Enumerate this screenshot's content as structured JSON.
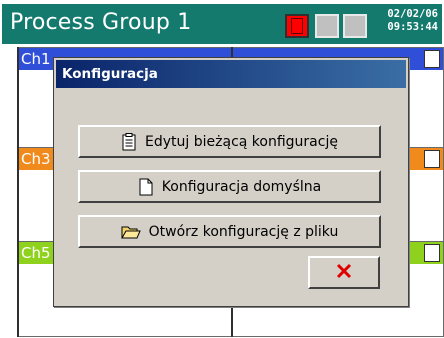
{
  "recorder": {
    "title": "Process Group 1",
    "date": "02/02/06",
    "time": "09:53:44",
    "channels": {
      "ch_top": "Ch1",
      "ch_mid": "Ch3",
      "ch_bot": "Ch5"
    }
  },
  "dialog": {
    "title": "Konfiguracja",
    "buttons": {
      "edit_current": "Edytuj bieżącą konfigurację",
      "default_config": "Konfiguracja domyślna",
      "open_from_file": "Otwórz konfigurację z pliku"
    }
  },
  "colors": {
    "titlebar": "#147a6e",
    "ch1": "#2f4fd8",
    "ch2": "#2f4fd8",
    "ch3": "#f08a1c",
    "ch4": "#f08a1c",
    "ch5": "#8fd21e",
    "ch6": "#8fd21e",
    "close_x": "#e00000"
  },
  "icons": {
    "alarm_indicator": "alarm-indicator-icon",
    "edit": "notepad-icon",
    "default": "blank-document-icon",
    "open": "open-folder-icon",
    "close": "close-x-icon"
  }
}
